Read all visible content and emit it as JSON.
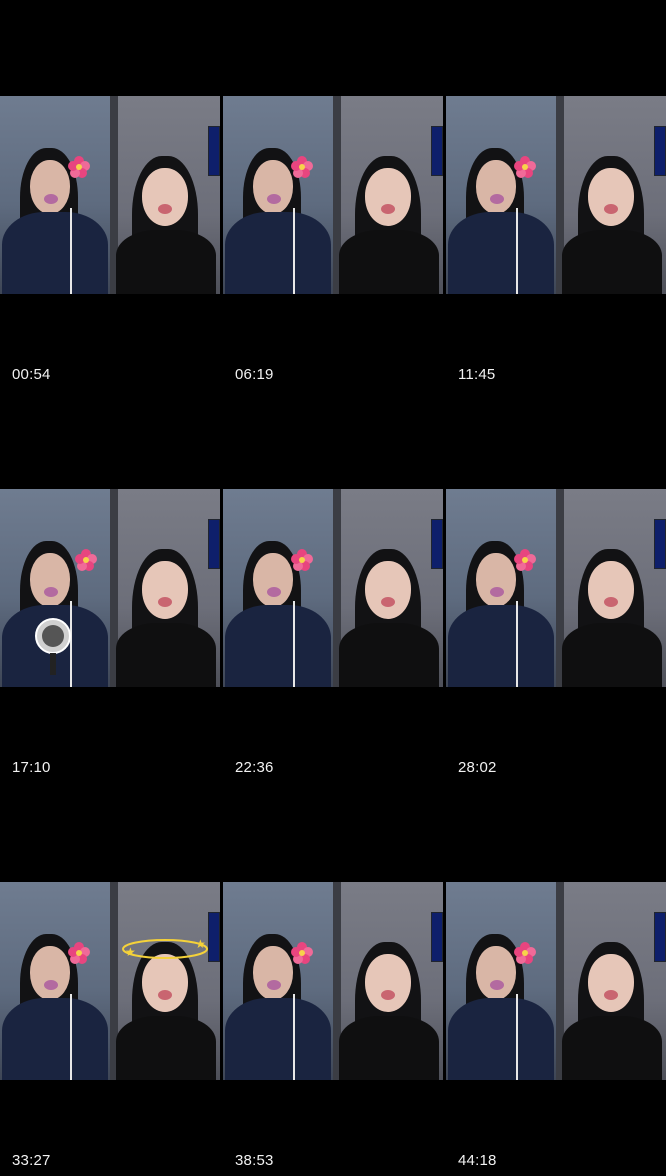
{
  "grid": {
    "cells": [
      {
        "timestamp": "00:54"
      },
      {
        "timestamp": "06:19"
      },
      {
        "timestamp": "11:45"
      },
      {
        "timestamp": "17:10"
      },
      {
        "timestamp": "22:36"
      },
      {
        "timestamp": "28:02"
      },
      {
        "timestamp": "33:27"
      },
      {
        "timestamp": "38:53"
      },
      {
        "timestamp": "44:18"
      }
    ]
  },
  "colors": {
    "background": "#000000",
    "timestamp_text": "#f2f2f2",
    "flower_pink": "#e8457f",
    "shirt_navy": "#1a2440"
  },
  "icons": [
    "flower-icon",
    "microphone-icon",
    "halo-stars-icon"
  ]
}
